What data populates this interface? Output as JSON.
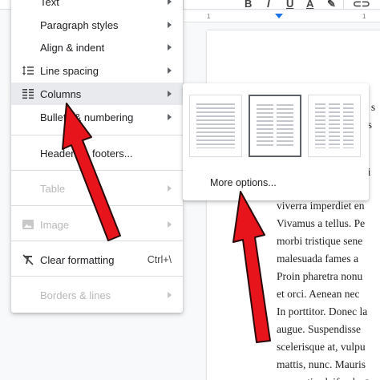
{
  "toolbar": {
    "buttons": [
      "B",
      "I",
      "U",
      "A"
    ]
  },
  "ruler": {
    "marks": [
      "1",
      "1"
    ]
  },
  "menu": {
    "items": [
      {
        "label": "Text",
        "icon": null,
        "submenu": true,
        "disabled": false
      },
      {
        "label": "Paragraph styles",
        "icon": null,
        "submenu": true,
        "disabled": false
      },
      {
        "label": "Align & indent",
        "icon": null,
        "submenu": true,
        "disabled": false
      },
      {
        "label": "Line spacing",
        "icon": "line-spacing-icon",
        "submenu": true,
        "disabled": false
      },
      {
        "label": "Columns",
        "icon": "columns-icon",
        "submenu": true,
        "disabled": false
      },
      {
        "label": "Bullets & numbering",
        "icon": null,
        "submenu": true,
        "disabled": false
      },
      {
        "label": "Headers & footers...",
        "icon": null,
        "submenu": false,
        "disabled": false
      },
      {
        "label": "Table",
        "icon": null,
        "submenu": true,
        "disabled": true
      },
      {
        "label": "Image",
        "icon": "image-icon",
        "submenu": true,
        "disabled": true
      },
      {
        "label": "Clear formatting",
        "icon": "clear-formatting-icon",
        "submenu": false,
        "disabled": false,
        "shortcut": "Ctrl+\\"
      },
      {
        "label": "Borders & lines",
        "icon": null,
        "submenu": true,
        "disabled": true
      }
    ]
  },
  "columns_submenu": {
    "presets": [
      {
        "columns": 1,
        "selected": false
      },
      {
        "columns": 2,
        "selected": true
      },
      {
        "columns": 3,
        "selected": false
      }
    ],
    "more_options": "More options..."
  },
  "document": {
    "lines": [
      "viverra imperdiet en",
      "Vivamus a tellus. Pe",
      "morbi tristique sene",
      "malesuada fames a",
      "Proin pharetra nonu",
      "et orci. Aenean nec",
      "In porttitor. Donec la",
      "augue. Suspendisse",
      "scelerisque at, vulpu",
      "mattis, nunc. Mauris",
      "venenatis eleifend."
    ],
    "right_fragments": [
      "r s",
      "is",
      "t",
      "li",
      "t",
      "a"
    ]
  },
  "colors": {
    "annotation_arrow": "#e8141c",
    "accent": "#1a73e8"
  }
}
